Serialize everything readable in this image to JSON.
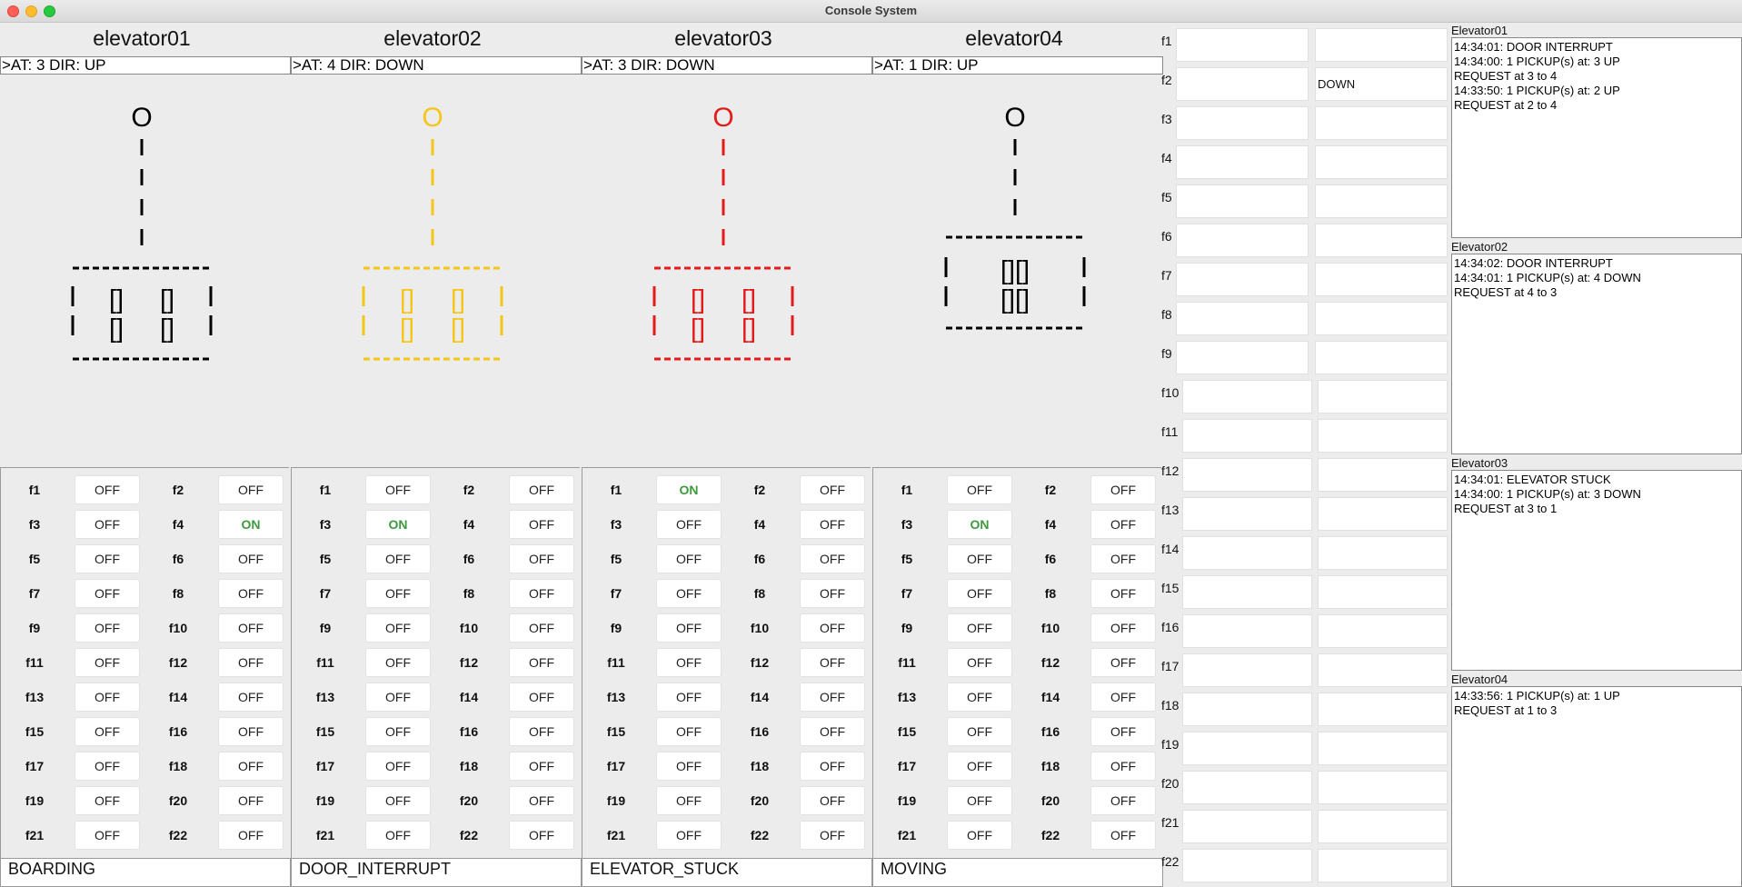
{
  "window": {
    "title": "Console System"
  },
  "elevators": [
    {
      "name": "elevator01",
      "status": ">AT: 3 DIR: UP",
      "state": "BOARDING",
      "color": "#000000",
      "buttons": [
        "OFF",
        "OFF",
        "OFF",
        "ON",
        "OFF",
        "OFF",
        "OFF",
        "OFF",
        "OFF",
        "OFF",
        "OFF",
        "OFF",
        "OFF",
        "OFF",
        "OFF",
        "OFF",
        "OFF",
        "OFF",
        "OFF",
        "OFF",
        "OFF",
        "OFF"
      ]
    },
    {
      "name": "elevator02",
      "status": ">AT: 4 DIR: DOWN",
      "state": "DOOR_INTERRUPT",
      "color": "#f5c518",
      "buttons": [
        "OFF",
        "OFF",
        "ON",
        "OFF",
        "OFF",
        "OFF",
        "OFF",
        "OFF",
        "OFF",
        "OFF",
        "OFF",
        "OFF",
        "OFF",
        "OFF",
        "OFF",
        "OFF",
        "OFF",
        "OFF",
        "OFF",
        "OFF",
        "OFF",
        "OFF"
      ]
    },
    {
      "name": "elevator03",
      "status": ">AT: 3 DIR: DOWN",
      "state": "ELEVATOR_STUCK",
      "color": "#e31b1b",
      "buttons": [
        "ON",
        "OFF",
        "OFF",
        "OFF",
        "OFF",
        "OFF",
        "OFF",
        "OFF",
        "OFF",
        "OFF",
        "OFF",
        "OFF",
        "OFF",
        "OFF",
        "OFF",
        "OFF",
        "OFF",
        "OFF",
        "OFF",
        "OFF",
        "OFF",
        "OFF"
      ]
    },
    {
      "name": "elevator04",
      "status": ">AT: 1 DIR: UP",
      "state": "MOVING",
      "color": "#000000",
      "buttons": [
        "OFF",
        "OFF",
        "ON",
        "OFF",
        "OFF",
        "OFF",
        "OFF",
        "OFF",
        "OFF",
        "OFF",
        "OFF",
        "OFF",
        "OFF",
        "OFF",
        "OFF",
        "OFF",
        "OFF",
        "OFF",
        "OFF",
        "OFF",
        "OFF",
        "OFF"
      ]
    }
  ],
  "floor_labels": [
    "f1",
    "f2",
    "f3",
    "f4",
    "f5",
    "f6",
    "f7",
    "f8",
    "f9",
    "f10",
    "f11",
    "f12",
    "f13",
    "f14",
    "f15",
    "f16",
    "f17",
    "f18",
    "f19",
    "f20",
    "f21",
    "f22"
  ],
  "floor_requests": [
    {
      "up": "",
      "down": ""
    },
    {
      "up": "",
      "down": "DOWN"
    },
    {
      "up": "",
      "down": ""
    },
    {
      "up": "",
      "down": ""
    },
    {
      "up": "",
      "down": ""
    },
    {
      "up": "",
      "down": ""
    },
    {
      "up": "",
      "down": ""
    },
    {
      "up": "",
      "down": ""
    },
    {
      "up": "",
      "down": ""
    },
    {
      "up": "",
      "down": ""
    },
    {
      "up": "",
      "down": ""
    },
    {
      "up": "",
      "down": ""
    },
    {
      "up": "",
      "down": ""
    },
    {
      "up": "",
      "down": ""
    },
    {
      "up": "",
      "down": ""
    },
    {
      "up": "",
      "down": ""
    },
    {
      "up": "",
      "down": ""
    },
    {
      "up": "",
      "down": ""
    },
    {
      "up": "",
      "down": ""
    },
    {
      "up": "",
      "down": ""
    },
    {
      "up": "",
      "down": ""
    },
    {
      "up": "",
      "down": ""
    }
  ],
  "logs": [
    {
      "title": "Elevator01",
      "lines": [
        "14:34:01: DOOR INTERRUPT",
        "14:34:00: 1 PICKUP(s) at: 3 UP",
        "REQUEST at 3 to 4",
        "14:33:50: 1 PICKUP(s) at: 2 UP",
        "REQUEST at 2 to 4"
      ]
    },
    {
      "title": "Elevator02",
      "lines": [
        "14:34:02: DOOR INTERRUPT",
        "14:34:01: 1 PICKUP(s) at: 4 DOWN",
        "REQUEST at 4 to 3"
      ]
    },
    {
      "title": "Elevator03",
      "lines": [
        "14:34:01: ELEVATOR STUCK",
        "14:34:00: 1 PICKUP(s) at: 3 DOWN",
        "REQUEST at 3 to 1"
      ]
    },
    {
      "title": "Elevator04",
      "lines": [
        "14:33:56: 1 PICKUP(s) at: 1 UP",
        "REQUEST at 1 to 3"
      ]
    }
  ]
}
